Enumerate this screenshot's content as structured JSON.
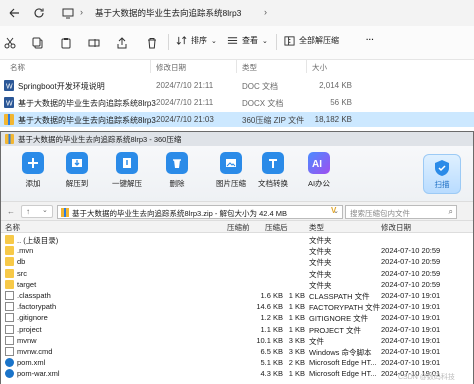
{
  "explorer": {
    "title": "基于大数据的毕业生去向追踪系统8lrp3",
    "toolbar": {
      "new_label": "新建",
      "sort_label": "排序",
      "view_label": "查看",
      "extract_all_label": "全部解压缩",
      "more_label": "···"
    },
    "columns": {
      "name": "名称",
      "modified": "修改日期",
      "type": "类型",
      "size": "大小"
    },
    "rows": [
      {
        "name": "Springboot开发环境说明",
        "modified": "2024/7/10 21:11",
        "type": "DOC 文档",
        "size": "2,014 KB",
        "icon": "word-doc-icon"
      },
      {
        "name": "基于大数据的毕业生去向追踪系统8lrp3",
        "modified": "2024/7/10 21:11",
        "type": "DOCX 文档",
        "size": "56 KB",
        "icon": "word-doc-icon"
      },
      {
        "name": "基于大数据的毕业生去向追踪系统8lrp3",
        "modified": "2024/7/10 21:03",
        "type": "360压缩 ZIP 文件",
        "size": "18,182 KB",
        "icon": "zip-icon",
        "selected": true
      }
    ]
  },
  "zip": {
    "title": "基于大数据的毕业生去向追踪系统8lrp3 - 360压缩",
    "tools": [
      {
        "label": "添加",
        "icon": "add-icon",
        "color": "#2b8be8"
      },
      {
        "label": "解压到",
        "icon": "extract-to-icon",
        "color": "#2b8be8"
      },
      {
        "label": "一键解压",
        "icon": "one-click-extract-icon",
        "color": "#2b8be8"
      },
      {
        "label": "删除",
        "icon": "delete-icon",
        "color": "#2b8be8"
      },
      {
        "label": "图片压缩",
        "icon": "image-compress-icon",
        "color": "#2b8be8"
      },
      {
        "label": "文档转换",
        "icon": "doc-convert-icon",
        "color": "#2b8be8"
      },
      {
        "label": "AI办公",
        "icon": "ai-office-icon",
        "color": "#7b4fe8"
      }
    ],
    "scan_label": "扫描",
    "path": "基于大数据的毕业生去向追踪系统8lrp3.zip - 解包大小为 42.4 MB",
    "search_placeholder": "搜索压缩包内文件",
    "columns": {
      "name": "名称",
      "compressed": "压缩前",
      "after": "压缩后",
      "type": "类型",
      "modified": "修改日期"
    },
    "rows": [
      {
        "name": ".. (上级目录)",
        "compressed": "",
        "after": "",
        "type": "文件夹",
        "modified": "",
        "kind": "folder"
      },
      {
        "name": ".mvn",
        "compressed": "",
        "after": "",
        "type": "文件夹",
        "modified": "2024-07-10 20:59",
        "kind": "folder"
      },
      {
        "name": "db",
        "compressed": "",
        "after": "",
        "type": "文件夹",
        "modified": "2024-07-10 20:59",
        "kind": "folder"
      },
      {
        "name": "src",
        "compressed": "",
        "after": "",
        "type": "文件夹",
        "modified": "2024-07-10 20:59",
        "kind": "folder"
      },
      {
        "name": "target",
        "compressed": "",
        "after": "",
        "type": "文件夹",
        "modified": "2024-07-10 20:59",
        "kind": "folder"
      },
      {
        "name": ".classpath",
        "compressed": "1.6 KB",
        "after": "1 KB",
        "type": "CLASSPATH 文件",
        "modified": "2024-07-10 19:01",
        "kind": "doc"
      },
      {
        "name": ".factorypath",
        "compressed": "14.6 KB",
        "after": "1 KB",
        "type": "FACTORYPATH 文件",
        "modified": "2024-07-10 19:01",
        "kind": "doc"
      },
      {
        "name": ".gitignore",
        "compressed": "1.2 KB",
        "after": "1 KB",
        "type": "GITIGNORE 文件",
        "modified": "2024-07-10 19:01",
        "kind": "doc"
      },
      {
        "name": ".project",
        "compressed": "1.1 KB",
        "after": "1 KB",
        "type": "PROJECT 文件",
        "modified": "2024-07-10 19:01",
        "kind": "doc"
      },
      {
        "name": "mvnw",
        "compressed": "10.1 KB",
        "after": "3 KB",
        "type": "文件",
        "modified": "2024-07-10 19:01",
        "kind": "doc"
      },
      {
        "name": "mvnw.cmd",
        "compressed": "6.5 KB",
        "after": "3 KB",
        "type": "Windows 命令脚本",
        "modified": "2024-07-10 19:01",
        "kind": "doc"
      },
      {
        "name": "pom.xml",
        "compressed": "5.1 KB",
        "after": "2 KB",
        "type": "Microsoft Edge HT...",
        "modified": "2024-07-10 19:01",
        "kind": "edge"
      },
      {
        "name": "pom-war.xml",
        "compressed": "4.3 KB",
        "after": "1 KB",
        "type": "Microsoft Edge HT...",
        "modified": "2024-07-10 19:01",
        "kind": "edge"
      }
    ]
  },
  "watermark": "CSDN @数码科技"
}
